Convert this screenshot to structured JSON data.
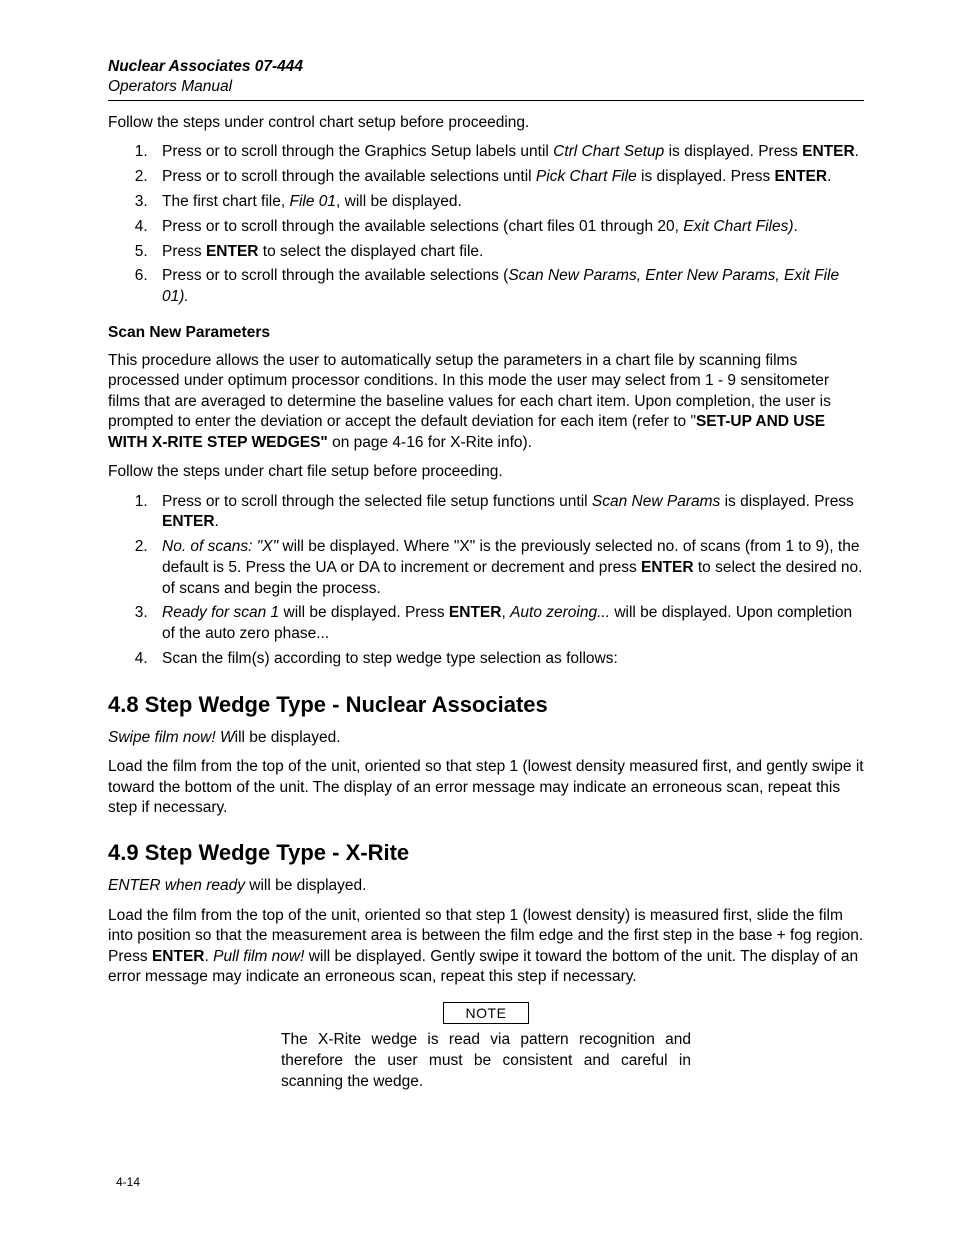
{
  "header": {
    "product": "Nuclear Associates 07-444",
    "subtitle": "Operators Manual"
  },
  "intro_line": "Follow the steps under control chart setup before proceeding.",
  "list1": {
    "i1_a": "Press  or  to scroll through the Graphics Setup labels until ",
    "i1_ital": "Ctrl Chart Setup",
    "i1_b": " is displayed.  Press ",
    "i1_bold": "ENTER",
    "i1_c": ".",
    "i2_a": "Press  or  to scroll through the available selections until ",
    "i2_ital": "Pick Chart File",
    "i2_b": " is displayed.  Press ",
    "i2_bold": "ENTER",
    "i2_c": ".",
    "i3_a": "The first chart file, ",
    "i3_ital": "File 01",
    "i3_b": ", will be displayed.",
    "i4_a": "Press  or  to scroll through the available selections (chart files 01 through 20, ",
    "i4_ital": "Exit Chart Files)",
    "i4_b": ".",
    "i5_a": "Press ",
    "i5_bold": "ENTER",
    "i5_b": " to select the displayed chart file.",
    "i6_a": "Press  or  to scroll through the available selections (",
    "i6_ital": "Scan New Params, Enter New Params, Exit File 01).",
    "i6_b": ""
  },
  "scan_new": {
    "heading": "Scan New Parameters",
    "p1_a": "This procedure allows the user to automatically setup the parameters in a chart file by scanning films processed under optimum processor conditions.  In this mode the user may select from 1 - 9 sensitometer films that are averaged to determine the baseline values for each chart item.  Upon completion, the user is prompted to enter the deviation or accept the default deviation for each item (refer to \"",
    "p1_bold": "SET-UP AND USE WITH X-RITE STEP WEDGES\"",
    "p1_b": " on page 4-16 for X-Rite info).",
    "p2": "Follow the steps under chart file setup before proceeding."
  },
  "list2": {
    "i1_a": "Press  or  to scroll through the selected file setup functions until ",
    "i1_ital": "Scan New Params",
    "i1_b": " is displayed.  Press ",
    "i1_bold": "ENTER",
    "i1_c": ".",
    "i2_ital_a": "No. of scans: \"X\"",
    "i2_a": " will be displayed.  Where \"X\" is the previously selected no. of scans (from 1 to 9), the default is 5.  Press the UA or DA to increment or decrement and press ",
    "i2_bold": "ENTER",
    "i2_b": " to select the desired no. of scans and begin the process.",
    "i3_ital_a": "Ready for scan 1",
    "i3_a": " will be displayed.  Press ",
    "i3_bold": "ENTER",
    "i3_b": ", ",
    "i3_ital_b": "Auto zeroing...",
    "i3_c": " will be displayed.  Upon completion of the auto zero phase...",
    "i4": "Scan the film(s) according to step wedge type selection as follows:"
  },
  "sec48": {
    "title": "4.8 Step Wedge Type - Nuclear Associates",
    "p1_ital": "Swipe film now! W",
    "p1_rest": "ill be displayed.",
    "p2": "Load the film from the top of the unit, oriented so that step 1 (lowest density measured first, and gently swipe it toward the bottom of the unit.  The display of an error message may indicate an erroneous scan, repeat this step if necessary."
  },
  "sec49": {
    "title": "4.9 Step Wedge Type - X-Rite",
    "p1_ital": "ENTER when ready",
    "p1_rest": " will be displayed.",
    "p2_a": "Load the film from the top of the unit, oriented so that step 1 (lowest density) is measured first, slide the film into position so that the measurement area is between the film edge and the first step in the base + fog region.  Press ",
    "p2_bold": "ENTER",
    "p2_b": ".  ",
    "p2_ital": "Pull film now!",
    "p2_c": " will be displayed. Gently swipe it toward the bottom of the unit.  The display of an error message may indicate an erroneous scan, repeat this step if necessary."
  },
  "note": {
    "label": "NOTE",
    "text": "The X-Rite wedge is read via pattern recognition and therefore the user must be consistent and careful in scanning the wedge."
  },
  "page_number": "4-14"
}
